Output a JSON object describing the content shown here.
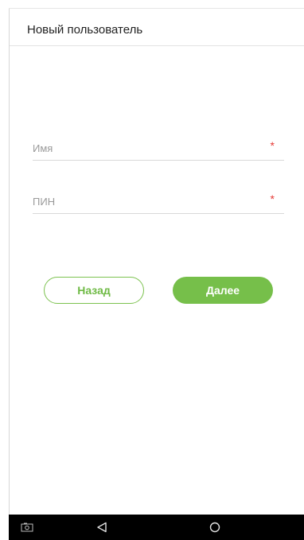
{
  "header": {
    "title": "Новый пользователь"
  },
  "form": {
    "name_field": {
      "placeholder": "Имя",
      "value": "",
      "required_mark": "*"
    },
    "pin_field": {
      "placeholder": "ПИН",
      "value": "",
      "required_mark": "*"
    }
  },
  "actions": {
    "back_label": "Назад",
    "next_label": "Далее"
  },
  "navbar": {
    "icons": [
      "screenshot-icon",
      "back-triangle-icon",
      "home-circle-icon"
    ]
  },
  "colors": {
    "accent": "#76bf4a",
    "required": "#e53935",
    "navbar": "#000000"
  }
}
